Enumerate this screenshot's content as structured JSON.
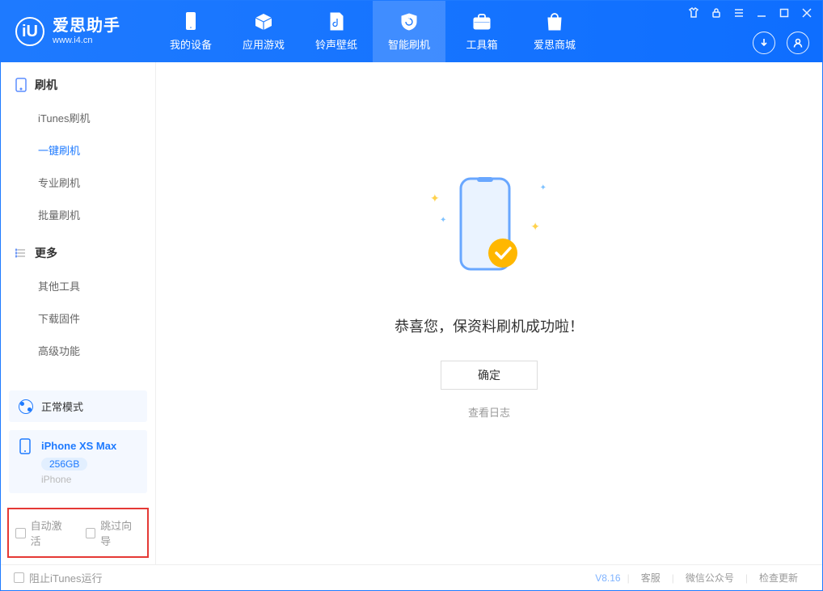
{
  "app": {
    "title": "爱思助手",
    "subtitle": "www.i4.cn"
  },
  "nav": {
    "items": [
      {
        "label": "我的设备"
      },
      {
        "label": "应用游戏"
      },
      {
        "label": "铃声壁纸"
      },
      {
        "label": "智能刷机"
      },
      {
        "label": "工具箱"
      },
      {
        "label": "爱思商城"
      }
    ]
  },
  "sidebar": {
    "section1": {
      "title": "刷机"
    },
    "flash_items": [
      {
        "label": "iTunes刷机"
      },
      {
        "label": "一键刷机"
      },
      {
        "label": "专业刷机"
      },
      {
        "label": "批量刷机"
      }
    ],
    "section2": {
      "title": "更多"
    },
    "more_items": [
      {
        "label": "其他工具"
      },
      {
        "label": "下载固件"
      },
      {
        "label": "高级功能"
      }
    ],
    "mode": {
      "label": "正常模式"
    },
    "device": {
      "name": "iPhone XS Max",
      "capacity": "256GB",
      "type": "iPhone"
    },
    "auto_activate": "自动激活",
    "skip_guide": "跳过向导"
  },
  "main": {
    "message": "恭喜您，保资料刷机成功啦！",
    "ok": "确定",
    "view_log": "查看日志"
  },
  "footer": {
    "block_itunes": "阻止iTunes运行",
    "version": "V8.16",
    "links": [
      "客服",
      "微信公众号",
      "检查更新"
    ]
  }
}
